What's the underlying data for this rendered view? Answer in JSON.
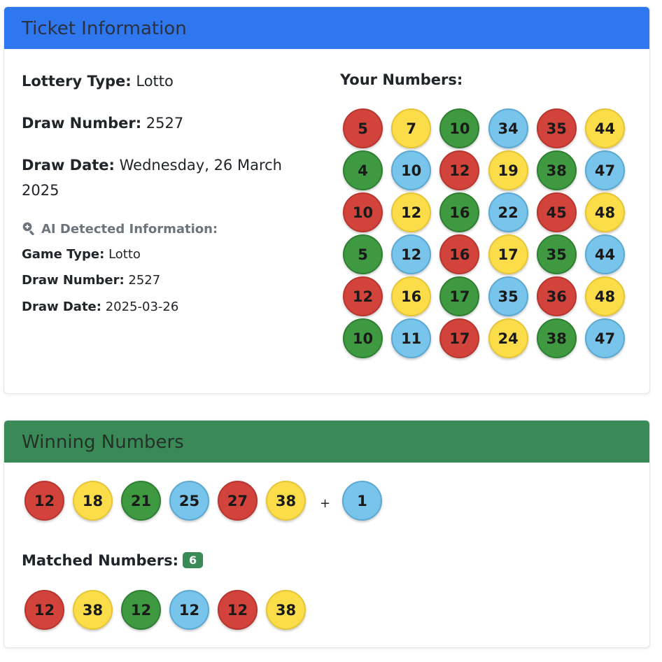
{
  "ticket": {
    "header": "Ticket Information",
    "lottery_type_label": "Lottery Type:",
    "lottery_type": "Lotto",
    "draw_number_label": "Draw Number:",
    "draw_number": "2527",
    "draw_date_label": "Draw Date:",
    "draw_date": "Wednesday, 26 March 2025",
    "ai": {
      "title": "AI Detected Information:",
      "game_type_label": "Game Type:",
      "game_type": "Lotto",
      "draw_number_label": "Draw Number:",
      "draw_number": "2527",
      "draw_date_label": "Draw Date:",
      "draw_date": "2025-03-26"
    },
    "your_numbers_title": "Your Numbers:",
    "rows": [
      [
        [
          "5",
          "red"
        ],
        [
          "7",
          "yellow"
        ],
        [
          "10",
          "green"
        ],
        [
          "34",
          "blue"
        ],
        [
          "35",
          "red"
        ],
        [
          "44",
          "yellow"
        ]
      ],
      [
        [
          "4",
          "green"
        ],
        [
          "10",
          "blue"
        ],
        [
          "12",
          "red"
        ],
        [
          "19",
          "yellow"
        ],
        [
          "38",
          "green"
        ],
        [
          "47",
          "blue"
        ]
      ],
      [
        [
          "10",
          "red"
        ],
        [
          "12",
          "yellow"
        ],
        [
          "16",
          "green"
        ],
        [
          "22",
          "blue"
        ],
        [
          "45",
          "red"
        ],
        [
          "48",
          "yellow"
        ]
      ],
      [
        [
          "5",
          "green"
        ],
        [
          "12",
          "blue"
        ],
        [
          "16",
          "red"
        ],
        [
          "17",
          "yellow"
        ],
        [
          "35",
          "green"
        ],
        [
          "44",
          "blue"
        ]
      ],
      [
        [
          "12",
          "red"
        ],
        [
          "16",
          "yellow"
        ],
        [
          "17",
          "green"
        ],
        [
          "35",
          "blue"
        ],
        [
          "36",
          "red"
        ],
        [
          "48",
          "yellow"
        ]
      ],
      [
        [
          "10",
          "green"
        ],
        [
          "11",
          "blue"
        ],
        [
          "17",
          "red"
        ],
        [
          "24",
          "yellow"
        ],
        [
          "38",
          "green"
        ],
        [
          "47",
          "blue"
        ]
      ]
    ]
  },
  "winning": {
    "header": "Winning Numbers",
    "numbers": [
      [
        "12",
        "red"
      ],
      [
        "18",
        "yellow"
      ],
      [
        "21",
        "green"
      ],
      [
        "25",
        "blue"
      ],
      [
        "27",
        "red"
      ],
      [
        "38",
        "yellow"
      ]
    ],
    "plus": "+",
    "bonus": [
      "1",
      "blue"
    ],
    "matched_label": "Matched Numbers:",
    "matched_count": "6",
    "matched": [
      [
        "12",
        "red"
      ],
      [
        "38",
        "yellow"
      ],
      [
        "12",
        "green"
      ],
      [
        "12",
        "blue"
      ],
      [
        "12",
        "red"
      ],
      [
        "38",
        "yellow"
      ]
    ]
  },
  "colors": {
    "red": "#d1433b",
    "yellow": "#fbdd4a",
    "green": "#3f9941",
    "blue": "#78c4ea",
    "ticket_header": "#2f77ee",
    "winning_header": "#3a8a58"
  }
}
